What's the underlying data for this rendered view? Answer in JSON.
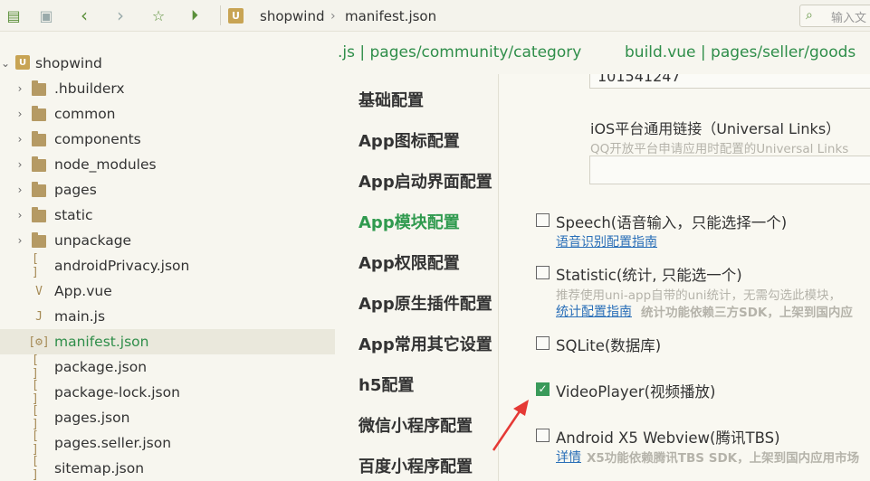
{
  "toolbar": {
    "breadcrumb": [
      "shopwind",
      "manifest.json"
    ],
    "search_placeholder": "输入文"
  },
  "sidebar": {
    "project": "shopwind",
    "items": [
      {
        "label": ".hbuilderx",
        "type": "folder"
      },
      {
        "label": "common",
        "type": "folder"
      },
      {
        "label": "components",
        "type": "folder"
      },
      {
        "label": "node_modules",
        "type": "folder"
      },
      {
        "label": "pages",
        "type": "folder"
      },
      {
        "label": "static",
        "type": "folder"
      },
      {
        "label": "unpackage",
        "type": "folder"
      },
      {
        "label": "androidPrivacy.json",
        "type": "json"
      },
      {
        "label": "App.vue",
        "type": "vue"
      },
      {
        "label": "main.js",
        "type": "js"
      },
      {
        "label": "manifest.json",
        "type": "manifest",
        "selected": true
      },
      {
        "label": "package.json",
        "type": "json"
      },
      {
        "label": "package-lock.json",
        "type": "json"
      },
      {
        "label": "pages.json",
        "type": "json"
      },
      {
        "label": "pages.seller.json",
        "type": "json"
      },
      {
        "label": "sitemap.json",
        "type": "json"
      }
    ]
  },
  "editor_tabs": {
    "tab1": ".js | pages/community/category",
    "tab2": "build.vue | pages/seller/goods"
  },
  "config_menu": {
    "items": [
      "基础配置",
      "App图标配置",
      "App启动界面配置",
      "App模块配置",
      "App权限配置",
      "App原生插件配置",
      "App常用其它设置",
      "h5配置",
      "微信小程序配置",
      "百度小程序配置"
    ],
    "active": "App模块配置"
  },
  "content": {
    "top_input_value": "101541247",
    "universal_links_title": "iOS平台通用链接（Universal Links）",
    "universal_links_hint": "QQ开放平台申请应用时配置的Universal Links",
    "options": [
      {
        "label": "Speech(语音输入，只能选择一个)",
        "checked": false,
        "link": "语音识别配置指南"
      },
      {
        "label": "Statistic(统计, 只能选一个)",
        "checked": false,
        "sub": "推荐使用uni-app自带的uni统计，无需勾选此模块，",
        "link": "统计配置指南",
        "note": "统计功能依赖三方SDK，上架到国内应"
      },
      {
        "label": "SQLite(数据库)",
        "checked": false
      },
      {
        "label": "VideoPlayer(视频播放)",
        "checked": true
      },
      {
        "label": "Android X5 Webview(腾讯TBS)",
        "checked": false,
        "link": "详情",
        "note": "X5功能依赖腾讯TBS SDK，上架到国内应用市场"
      }
    ]
  },
  "colors": {
    "accent_green": "#2f9a4e",
    "link_blue": "#2a6fb8",
    "arrow_red": "#e53935"
  }
}
